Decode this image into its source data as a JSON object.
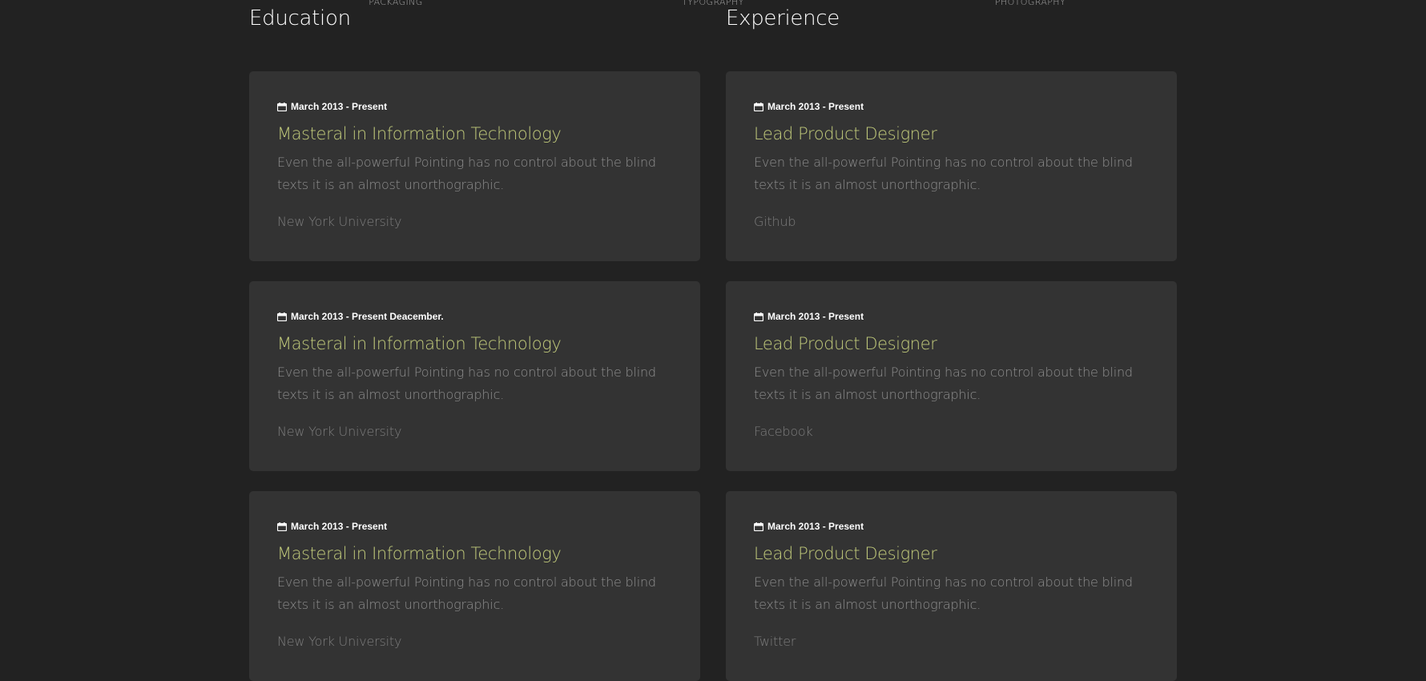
{
  "top_nav": {
    "items": [
      {
        "label": "PACKAGING"
      },
      {
        "label": "TYPOGRAPHY"
      },
      {
        "label": "PHOTOGRAPHY"
      }
    ]
  },
  "education": {
    "title": "Education",
    "entries": [
      {
        "date": "March 2013 - Present",
        "title": "Masteral in Information Technology",
        "description": "Even the all-powerful Pointing has no control about the blind texts it is an almost unorthographic.",
        "organization": "New York University"
      },
      {
        "date": "March 2013 - Present Deacember.",
        "title": "Masteral in Information Technology",
        "description": "Even the all-powerful Pointing has no control about the blind texts it is an almost unorthographic.",
        "organization": "New York University"
      },
      {
        "date": "March 2013 - Present",
        "title": "Masteral in Information Technology",
        "description": "Even the all-powerful Pointing has no control about the blind texts it is an almost unorthographic.",
        "organization": "New York University"
      }
    ]
  },
  "experience": {
    "title": "Experience",
    "entries": [
      {
        "date": "March 2013 - Present",
        "title": "Lead Product Designer",
        "description": "Even the all-powerful Pointing has no control about the blind texts it is an almost unorthographic.",
        "organization": "Github"
      },
      {
        "date": "March 2013 - Present",
        "title": "Lead Product Designer",
        "description": "Even the all-powerful Pointing has no control about the blind texts it is an almost unorthographic.",
        "organization": "Facebook"
      },
      {
        "date": "March 2013 - Present",
        "title": "Lead Product Designer",
        "description": "Even the all-powerful Pointing has no control about the blind texts it is an almost unorthographic.",
        "organization": "Twitter"
      }
    ]
  },
  "icons": {
    "date_icon": "calendar-icon"
  },
  "colors": {
    "background": "#222222",
    "card": "#333333",
    "accent": "#c2cb7b",
    "text_muted": "#8f8f8f"
  }
}
